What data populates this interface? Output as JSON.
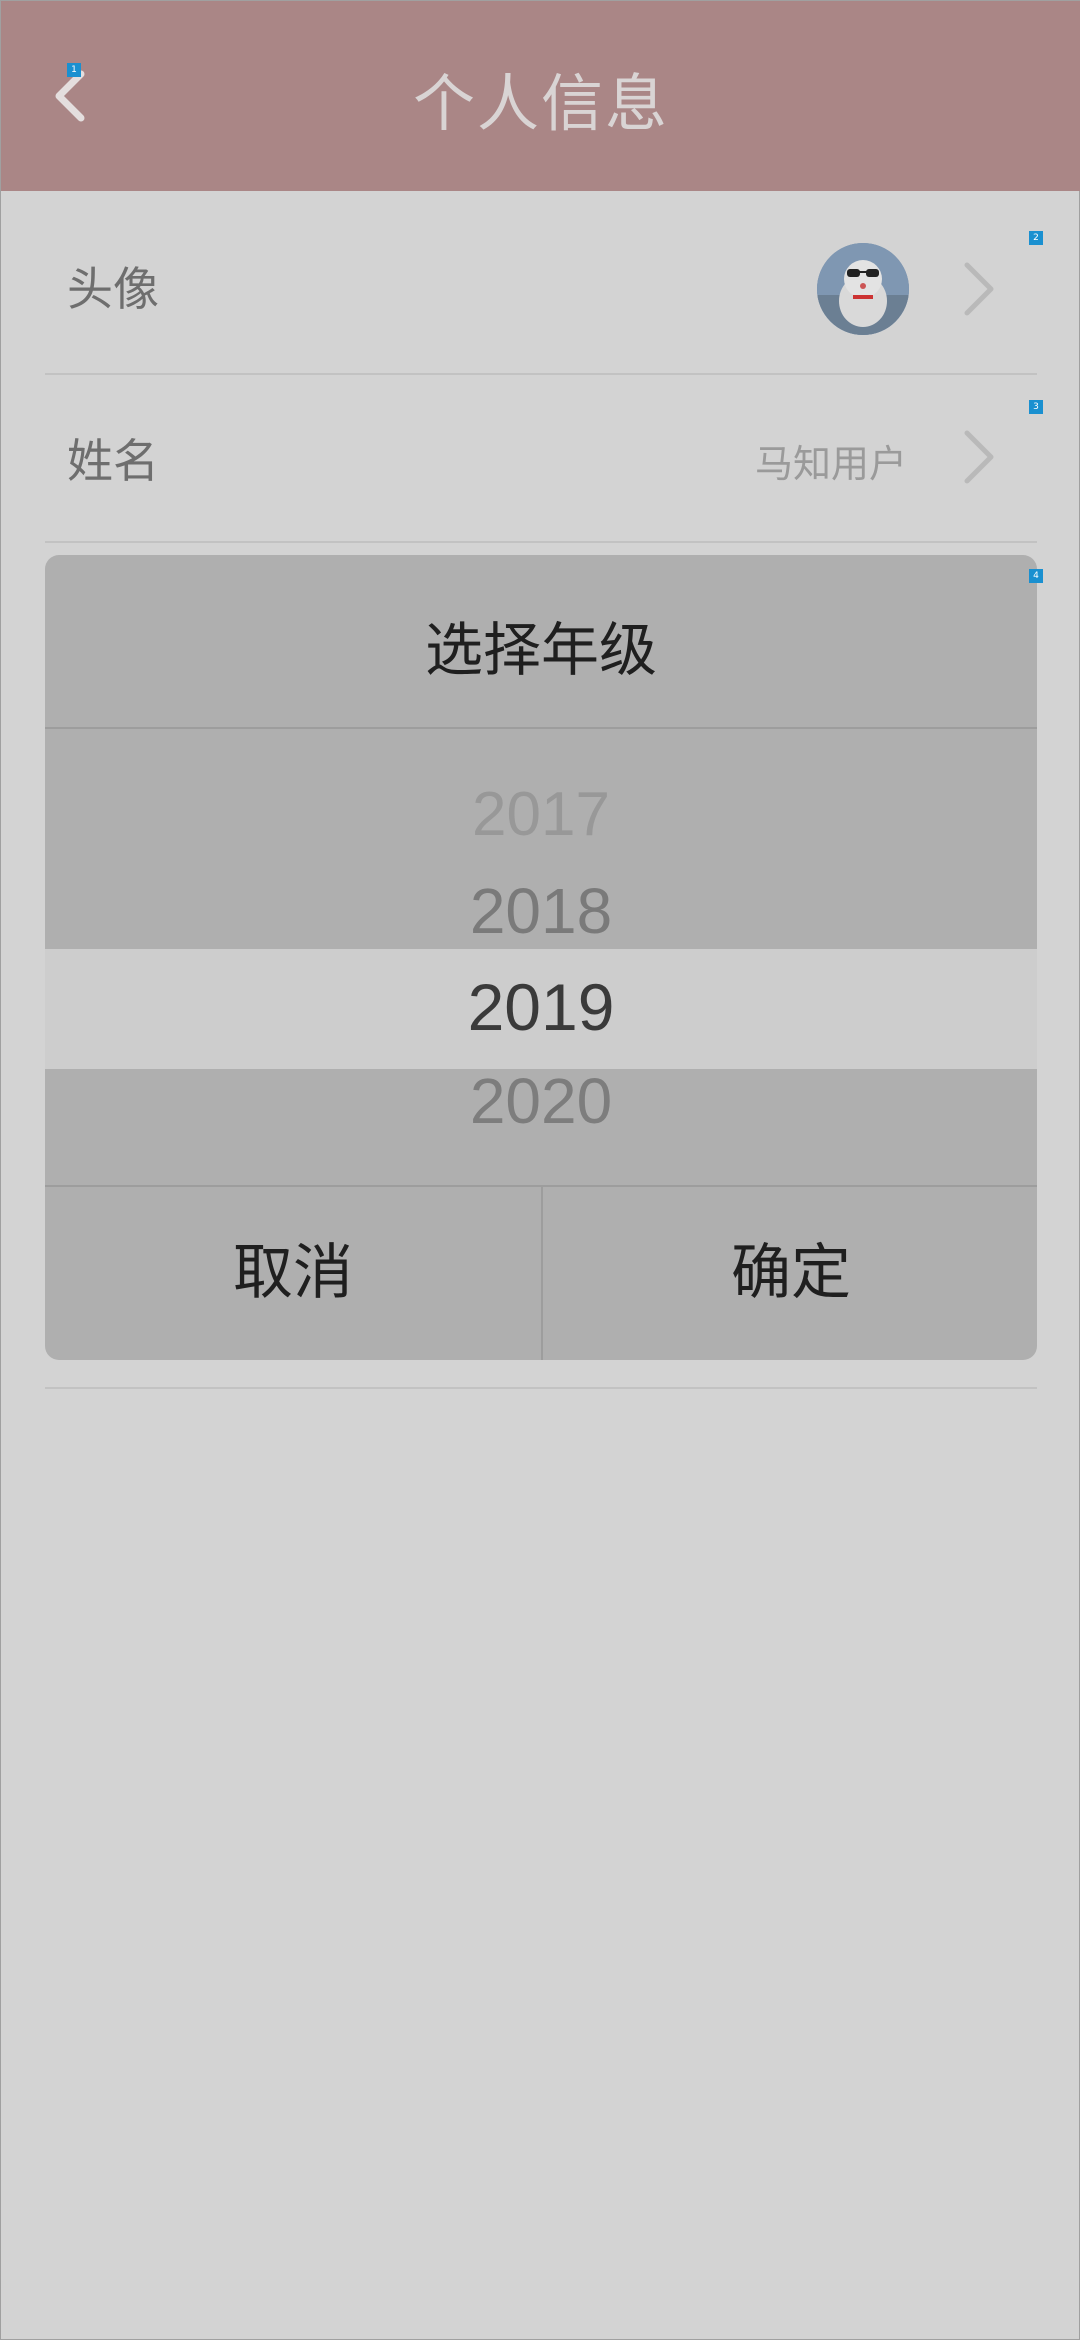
{
  "header": {
    "title": "个人信息",
    "back_icon": "chevron-left-icon"
  },
  "rows": [
    {
      "label": "头像",
      "value": "",
      "has_avatar": true
    },
    {
      "label": "姓名",
      "value": "马知用户"
    }
  ],
  "dialog": {
    "title": "选择年级",
    "options": [
      "2017",
      "2018",
      "2019",
      "2020"
    ],
    "selected": "2019",
    "cancel_label": "取消",
    "confirm_label": "确定"
  },
  "markers": [
    "1",
    "2",
    "3",
    "4"
  ],
  "colors": {
    "header_bg": "#aa8686",
    "page_bg": "#d3d3d3",
    "dialog_bg": "#afafaf",
    "highlight_bg": "#cdcdcd",
    "marker": "#1a90d0"
  }
}
